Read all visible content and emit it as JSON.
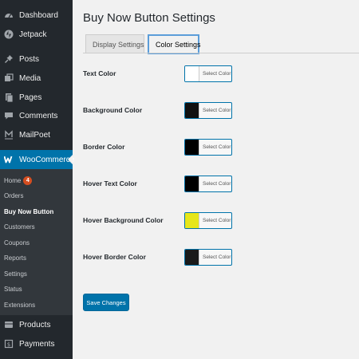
{
  "sidebar": {
    "top_items": [
      {
        "label": "Dashboard",
        "icon": "dashboard-icon"
      },
      {
        "label": "Jetpack",
        "icon": "jetpack-icon"
      },
      {
        "label": "Posts",
        "icon": "pin-icon"
      },
      {
        "label": "Media",
        "icon": "media-icon"
      },
      {
        "label": "Pages",
        "icon": "pages-icon"
      },
      {
        "label": "Comments",
        "icon": "comments-icon"
      },
      {
        "label": "MailPoet",
        "icon": "mailpoet-icon"
      }
    ],
    "woocommerce": {
      "label": "WooCommerce",
      "icon": "woocommerce-icon"
    },
    "submenu": [
      {
        "label": "Home",
        "badge": "4"
      },
      {
        "label": "Orders"
      },
      {
        "label": "Buy Now Button"
      },
      {
        "label": "Customers"
      },
      {
        "label": "Coupons"
      },
      {
        "label": "Reports"
      },
      {
        "label": "Settings"
      },
      {
        "label": "Status"
      },
      {
        "label": "Extensions"
      }
    ],
    "bottom_items": [
      {
        "label": "Products",
        "icon": "products-icon"
      },
      {
        "label": "Payments",
        "icon": "payments-icon"
      }
    ]
  },
  "main": {
    "title": "Buy Now Button Settings",
    "tabs": [
      {
        "label": "Display Settings"
      },
      {
        "label": "Color Settings"
      }
    ],
    "rows": [
      {
        "label": "Text Color",
        "button": "Select Color",
        "swatch": "#ffffff"
      },
      {
        "label": "Background Color",
        "button": "Select Color",
        "swatch": "#111111"
      },
      {
        "label": "Border Color",
        "button": "Select Color",
        "swatch": "#000000"
      },
      {
        "label": "Hover Text Color",
        "button": "Select Color",
        "swatch": "#000000"
      },
      {
        "label": "Hover Background Color",
        "button": "Select Color",
        "swatch": "#e6e619"
      },
      {
        "label": "Hover Border Color",
        "button": "Select Color",
        "swatch": "#1a1a1a"
      }
    ],
    "save_label": "Save Changes"
  },
  "colors": {
    "sidebar_bg": "#23282d",
    "submenu_bg": "#32373c",
    "accent": "#0073aa",
    "badge": "#d54e21"
  }
}
